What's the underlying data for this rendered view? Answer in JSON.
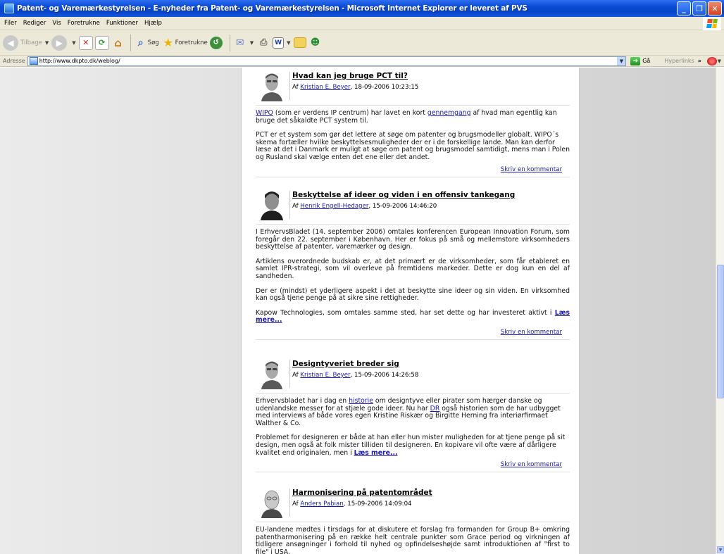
{
  "window": {
    "title": "Patent- og Varemærkestyrelsen - E-nyheder fra Patent- og Varemærkestyrelsen - Microsoft Internet Explorer er leveret af PVS"
  },
  "menu": [
    "Filer",
    "Rediger",
    "Vis",
    "Foretrukne",
    "Funktioner",
    "Hjælp"
  ],
  "toolbar": {
    "back_label": "Tilbage",
    "search_label": "Søg",
    "favorites_label": "Foretrukne"
  },
  "address": {
    "label": "Adresse",
    "url": "http://www.dkpto.dk/weblog/",
    "go_label": "Gå",
    "links_label": "Hyperlinks"
  },
  "posts": [
    {
      "title": "Hvad kan jeg bruge PCT til?",
      "by": "Af",
      "author": "Kristian E. Beyer",
      "date": ", 18-09-2006 10:23:15",
      "p1_link1": "WIPO",
      "p1_t1": " (som er verdens IP centrum) har lavet en kort ",
      "p1_link2": "gennemgang",
      "p1_t2": " af hvad man egentlig kan bruge det såkaldte PCT system til.",
      "p2": "PCT er et system som gør det lettere at søge om patenter og brugsmodeller globalt. WIPO´s skema fortæller hvilke beskyttelsesmuligheder der er i de forskellige lande. Man kan derfor læse at det i Danmark er muligt at søge om patent og brugsmodel samtidigt, mens man i Polen og Rusland skal vælge enten det ene eller det andet.",
      "comment": "Skriv en kommentar"
    },
    {
      "title": "Beskyttelse af ideer og viden i en offensiv tankegang",
      "by": "Af",
      "author": "Henrik Engell-Hedager",
      "date": ", 15-09-2006 14:46:20",
      "p1": "I ErhvervsBladet (14. september 2006) omtales konferencen European Innovation Forum, som foregår den 22. september i København. Her er fokus på små og mellemstore virksomheders beskyttelse af patenter, varemærker og design.",
      "p2": "Artiklens overordnede budskab er, at det primært er de virksomheder, som får etableret en samlet IPR-strategi, som vil overleve på fremtidens markeder. Dette er dog kun en del af sandheden.",
      "p3": "Der er (mindst) et yderligere aspekt i det at beskytte sine ideer og sin viden. En virksomhed kan også tjene penge på at sikre sine rettigheder.",
      "p4": "Kapow Technologies, som omtales samme sted, har set dette og har investeret aktivt i ",
      "more": "Læs mere...",
      "comment": "Skriv en kommentar"
    },
    {
      "title": "Designtyveriet breder sig",
      "by": "Af",
      "author": "Kristian E. Beyer",
      "date": ", 15-09-2006 14:26:58",
      "p1_t1": "Erhvervsbladet har i dag en ",
      "p1_link1": "historie",
      "p1_t2": " om designtyve eller pirater som hærger danske og udenlandske messer for at stjæle gode ideer. Nu har ",
      "p1_link2": "DR",
      "p1_t3": " også historien som de har udbygget med interviews af både vores egen Kristine Riskær og Birgitte Herning fra interiørfirmaet Walther & Co.",
      "p2": "Problemet for designeren er både at han eller hun mister muligheden for at tjene penge på sit design, men også at folk mister tilliden til designeren. En kopivare vil ofte være af dårligere kvalitet end originalen, men i ",
      "more": "Læs mere...",
      "comment": "Skriv en kommentar"
    },
    {
      "title": "Harmonisering på patentområdet",
      "by": "Af",
      "author": "Anders Pabian",
      "date": ", 15-09-2006 14:09:04",
      "p1": "EU-landene mødtes i tirsdags for at diskutere et forslag fra formanden for Group B+ omkring patentharmonisering på en række helt centrale punkter som Grace period og virkningen af tidligere ansøgninger i forhold til nyhed og opfindelseshøjde samt introduktionen af \"first to file\" i USA."
    }
  ]
}
